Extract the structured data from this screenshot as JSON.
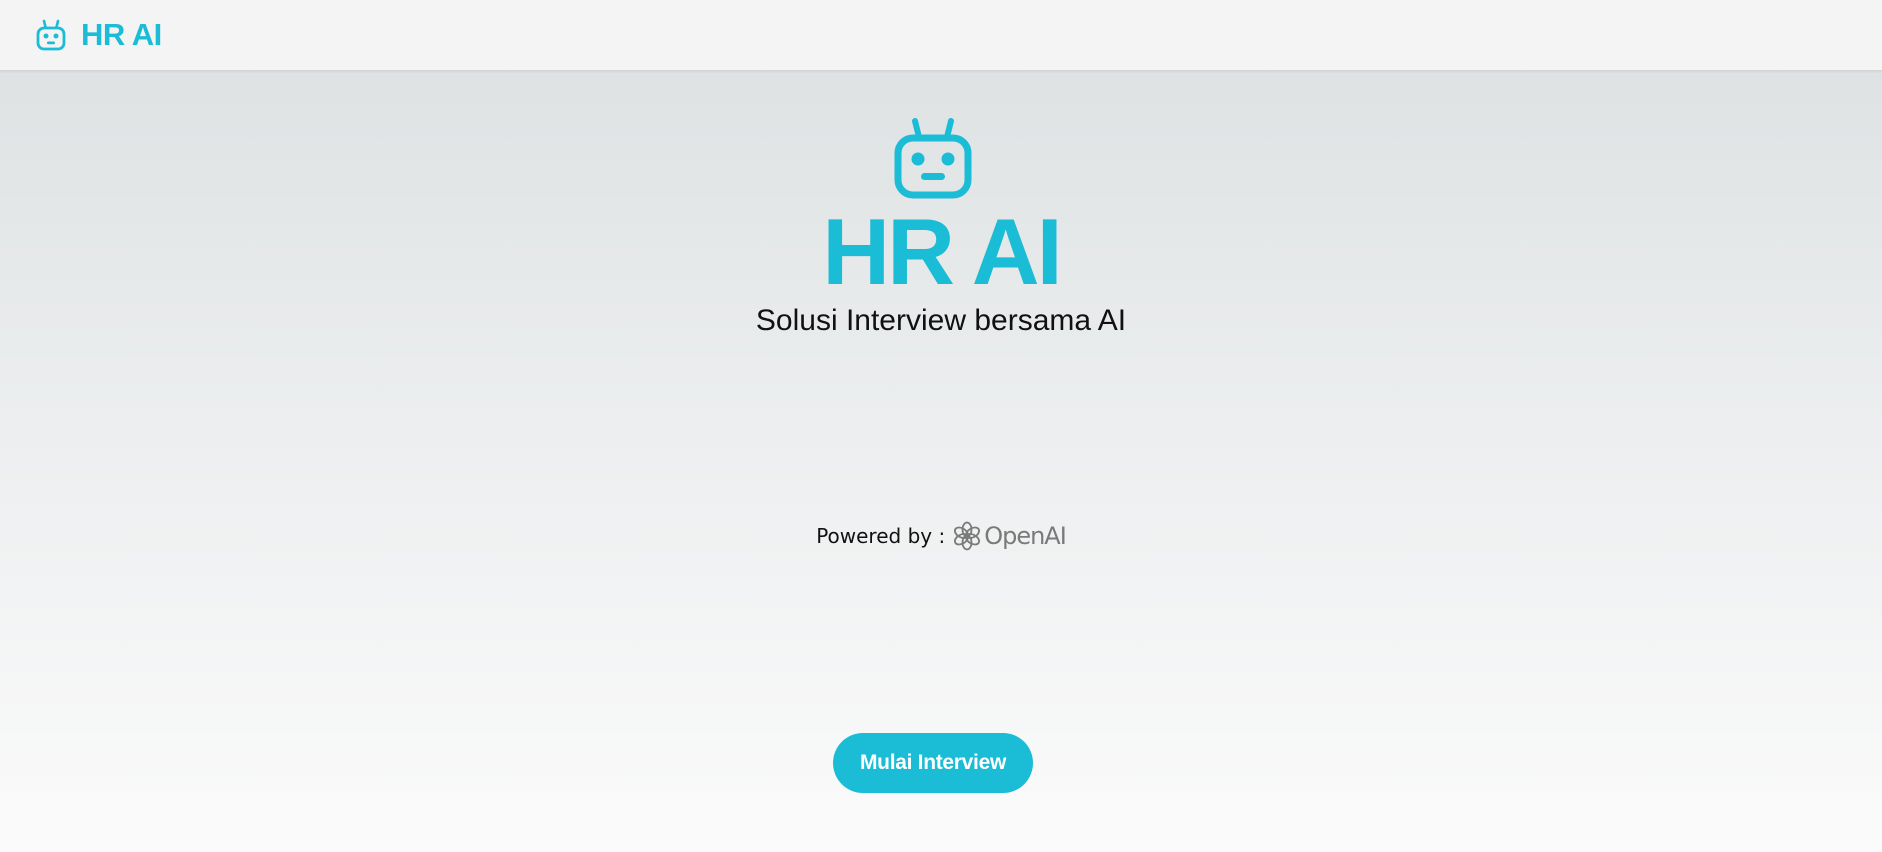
{
  "colors": {
    "accent": "#1bbcd6",
    "navbar_bg": "#f4f4f4",
    "text": "#111111",
    "openai_gray": "#7a7a7a"
  },
  "navbar": {
    "brand_icon": "robot-icon",
    "brand_name": "HR AI"
  },
  "hero": {
    "icon": "robot-icon",
    "title": "HR AI",
    "subtitle": "Solusi Interview bersama AI"
  },
  "powered_by": {
    "label": "Powered by :",
    "logo_icon": "openai-icon",
    "logo_text": "OpenAI"
  },
  "cta": {
    "label": "Mulai Interview"
  }
}
